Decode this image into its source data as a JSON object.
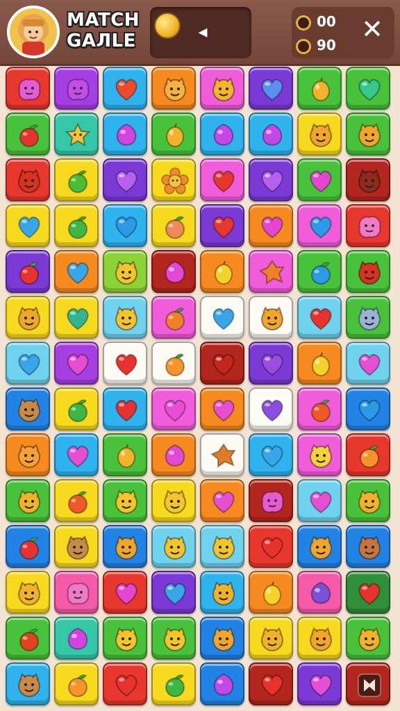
{
  "header": {
    "title_line1": "MATCH",
    "title_line2": "GAЛLE",
    "stat_top": "00",
    "stat_bottom": "90",
    "avatar_icon": "girl-avatar-icon",
    "coin_icon": "coin-icon",
    "back_icon": "back-arrow-icon",
    "close_icon": "close-x-icon"
  },
  "colors": {
    "red": "#e8372c",
    "purple": "#a63fe3",
    "skyblue": "#2fb3ef",
    "orange": "#f68a1f",
    "magenta": "#f05cd9",
    "violet": "#7b3ad6",
    "green": "#48c23a",
    "yellow": "#f7d91e",
    "teal": "#35c8a8",
    "blue": "#2283e6",
    "darkred": "#b3261e",
    "white": "#fbfbf4",
    "cyan": "#6fd2ee",
    "lime": "#8bd336",
    "darkgreen": "#2f8f3a",
    "pink": "#f45aa8"
  },
  "grid": {
    "rows": 14,
    "cols": 8,
    "cells": [
      [
        [
          "red",
          "blob",
          "#e55bd4"
        ],
        [
          "purple",
          "blob",
          "#c34de6"
        ],
        [
          "skyblue",
          "heart",
          "#f04a2c"
        ],
        [
          "orange",
          "face",
          "#f6b23c"
        ],
        [
          "magenta",
          "face",
          "#f5b52a"
        ],
        [
          "violet",
          "heart",
          "#5a8ff0"
        ],
        [
          "green",
          "lemon",
          "#f3b22a"
        ],
        [
          "green",
          "heart",
          "#38c78c"
        ]
      ],
      [
        [
          "green",
          "apple",
          "#e8322d"
        ],
        [
          "teal",
          "star",
          "#f6c33a"
        ],
        [
          "skyblue",
          "gem",
          "#d442e0"
        ],
        [
          "green",
          "lemon",
          "#f3b22a"
        ],
        [
          "skyblue",
          "gem",
          "#c447e6"
        ],
        [
          "skyblue",
          "gem",
          "#c447e6"
        ],
        [
          "yellow",
          "face",
          "#f1a52a"
        ],
        [
          "green",
          "face",
          "#f1a52a"
        ]
      ],
      [
        [
          "red",
          "face",
          "#d9321f"
        ],
        [
          "yellow",
          "apple",
          "#4bbd35"
        ],
        [
          "violet",
          "heart",
          "#b560ee"
        ],
        [
          "yellow",
          "flower",
          "#f28a2a"
        ],
        [
          "magenta",
          "heart",
          "#e8372c"
        ],
        [
          "violet",
          "heart",
          "#b560ee"
        ],
        [
          "green",
          "heart",
          "#e545d0"
        ],
        [
          "darkred",
          "face",
          "#8e2b1c"
        ]
      ],
      [
        [
          "yellow",
          "heart",
          "#3aa6ea"
        ],
        [
          "yellow",
          "apple",
          "#3cb744"
        ],
        [
          "skyblue",
          "heart",
          "#2c9ae6"
        ],
        [
          "yellow",
          "apple",
          "#f08a5a"
        ],
        [
          "violet",
          "heart",
          "#e8372c"
        ],
        [
          "orange",
          "heart",
          "#e545d0"
        ],
        [
          "magenta",
          "heart",
          "#2c9ae6"
        ],
        [
          "red",
          "blob",
          "#f07ac8"
        ]
      ],
      [
        [
          "violet",
          "apple",
          "#e8322d"
        ],
        [
          "orange",
          "heart",
          "#3aa6ea"
        ],
        [
          "lime",
          "face",
          "#f3c52a"
        ],
        [
          "darkred",
          "gem",
          "#e24ad6"
        ],
        [
          "orange",
          "lemon",
          "#f3d22a"
        ],
        [
          "magenta",
          "leaf",
          "#f07f28"
        ],
        [
          "green",
          "apple",
          "#2c9ae6"
        ],
        [
          "green",
          "face",
          "#d9321f"
        ]
      ],
      [
        [
          "yellow",
          "face",
          "#f1a52a"
        ],
        [
          "yellow",
          "heart",
          "#2fb591"
        ],
        [
          "cyan",
          "face",
          "#f3c52a"
        ],
        [
          "magenta",
          "apple",
          "#f07f28"
        ],
        [
          "white",
          "heart",
          "#3aa6ea"
        ],
        [
          "white",
          "face",
          "#f1a52a"
        ],
        [
          "cyan",
          "heart",
          "#e8322d"
        ],
        [
          "green",
          "face",
          "#9ab2d8"
        ]
      ],
      [
        [
          "cyan",
          "heart",
          "#3aa6ea"
        ],
        [
          "purple",
          "heart",
          "#e74fd3"
        ],
        [
          "white",
          "heart",
          "#e8322d"
        ],
        [
          "white",
          "apple",
          "#f5942a"
        ],
        [
          "darkred",
          "heart",
          "#c3261c"
        ],
        [
          "violet",
          "heart",
          "#9b4de0"
        ],
        [
          "orange",
          "lemon",
          "#f3d22a"
        ],
        [
          "cyan",
          "heart",
          "#e74fd3"
        ]
      ],
      [
        [
          "blue",
          "face",
          "#c98a47"
        ],
        [
          "yellow",
          "apple",
          "#3cb744"
        ],
        [
          "skyblue",
          "heart",
          "#e8322d"
        ],
        [
          "magenta",
          "heart",
          "#e74fd3"
        ],
        [
          "orange",
          "heart",
          "#e74fd3"
        ],
        [
          "white",
          "heart",
          "#8b4ee2"
        ],
        [
          "magenta",
          "apple",
          "#f05a22"
        ],
        [
          "blue",
          "heart",
          "#2c9ae6"
        ]
      ],
      [
        [
          "orange",
          "face",
          "#f6a03a"
        ],
        [
          "skyblue",
          "heart",
          "#e74fd3"
        ],
        [
          "green",
          "lemon",
          "#f3b22a"
        ],
        [
          "orange",
          "gem",
          "#e24ad6"
        ],
        [
          "white",
          "leaf",
          "#e37a28"
        ],
        [
          "skyblue",
          "heart",
          "#3aa6ea"
        ],
        [
          "magenta",
          "face",
          "#f6d23a"
        ],
        [
          "red",
          "apple",
          "#f5942a"
        ]
      ],
      [
        [
          "green",
          "face",
          "#f1b22a"
        ],
        [
          "yellow",
          "apple",
          "#f0582a"
        ],
        [
          "green",
          "face",
          "#f3c52a"
        ],
        [
          "yellow",
          "face",
          "#f3c52a"
        ],
        [
          "orange",
          "heart",
          "#e74fd3"
        ],
        [
          "darkred",
          "blob",
          "#e55bd4"
        ],
        [
          "cyan",
          "heart",
          "#e74fd3"
        ],
        [
          "green",
          "face",
          "#f1b22a"
        ]
      ],
      [
        [
          "blue",
          "apple",
          "#e8322d"
        ],
        [
          "yellow",
          "face",
          "#c98a47"
        ],
        [
          "blue",
          "face",
          "#f1a52a"
        ],
        [
          "cyan",
          "face",
          "#f3c52a"
        ],
        [
          "cyan",
          "face",
          "#f3c52a"
        ],
        [
          "red",
          "heart",
          "#e8322d"
        ],
        [
          "blue",
          "face",
          "#f1a52a"
        ],
        [
          "blue",
          "face",
          "#c9743a"
        ]
      ],
      [
        [
          "yellow",
          "face",
          "#f1b22a"
        ],
        [
          "pink",
          "blob",
          "#f07ac8"
        ],
        [
          "red",
          "heart",
          "#e545d0"
        ],
        [
          "violet",
          "heart",
          "#3aa6ea"
        ],
        [
          "skyblue",
          "face",
          "#f1b22a"
        ],
        [
          "orange",
          "lemon",
          "#f3d22a"
        ],
        [
          "pink",
          "gem",
          "#7b4fd8"
        ],
        [
          "darkgreen",
          "heart",
          "#e8322d"
        ]
      ],
      [
        [
          "green",
          "apple",
          "#e0441e"
        ],
        [
          "teal",
          "gem",
          "#d442e0"
        ],
        [
          "green",
          "face",
          "#f3c52a"
        ],
        [
          "green",
          "face",
          "#f3c52a"
        ],
        [
          "blue",
          "face",
          "#f1a52a"
        ],
        [
          "yellow",
          "face",
          "#f1b22a"
        ],
        [
          "yellow",
          "face",
          "#f1a52a"
        ],
        [
          "green",
          "face",
          "#f1b22a"
        ]
      ],
      [
        [
          "skyblue",
          "face",
          "#c98a47"
        ],
        [
          "yellow",
          "apple",
          "#f5942a"
        ],
        [
          "red",
          "heart",
          "#e8322d"
        ],
        [
          "yellow",
          "apple",
          "#3cb744"
        ],
        [
          "blue",
          "gem",
          "#c447e6"
        ],
        [
          "darkred",
          "heart",
          "#e8322d"
        ],
        [
          "violet",
          "heart",
          "#e74fd3"
        ],
        [
          "darkred",
          "menu",
          "#f3e3d3"
        ]
      ]
    ]
  }
}
